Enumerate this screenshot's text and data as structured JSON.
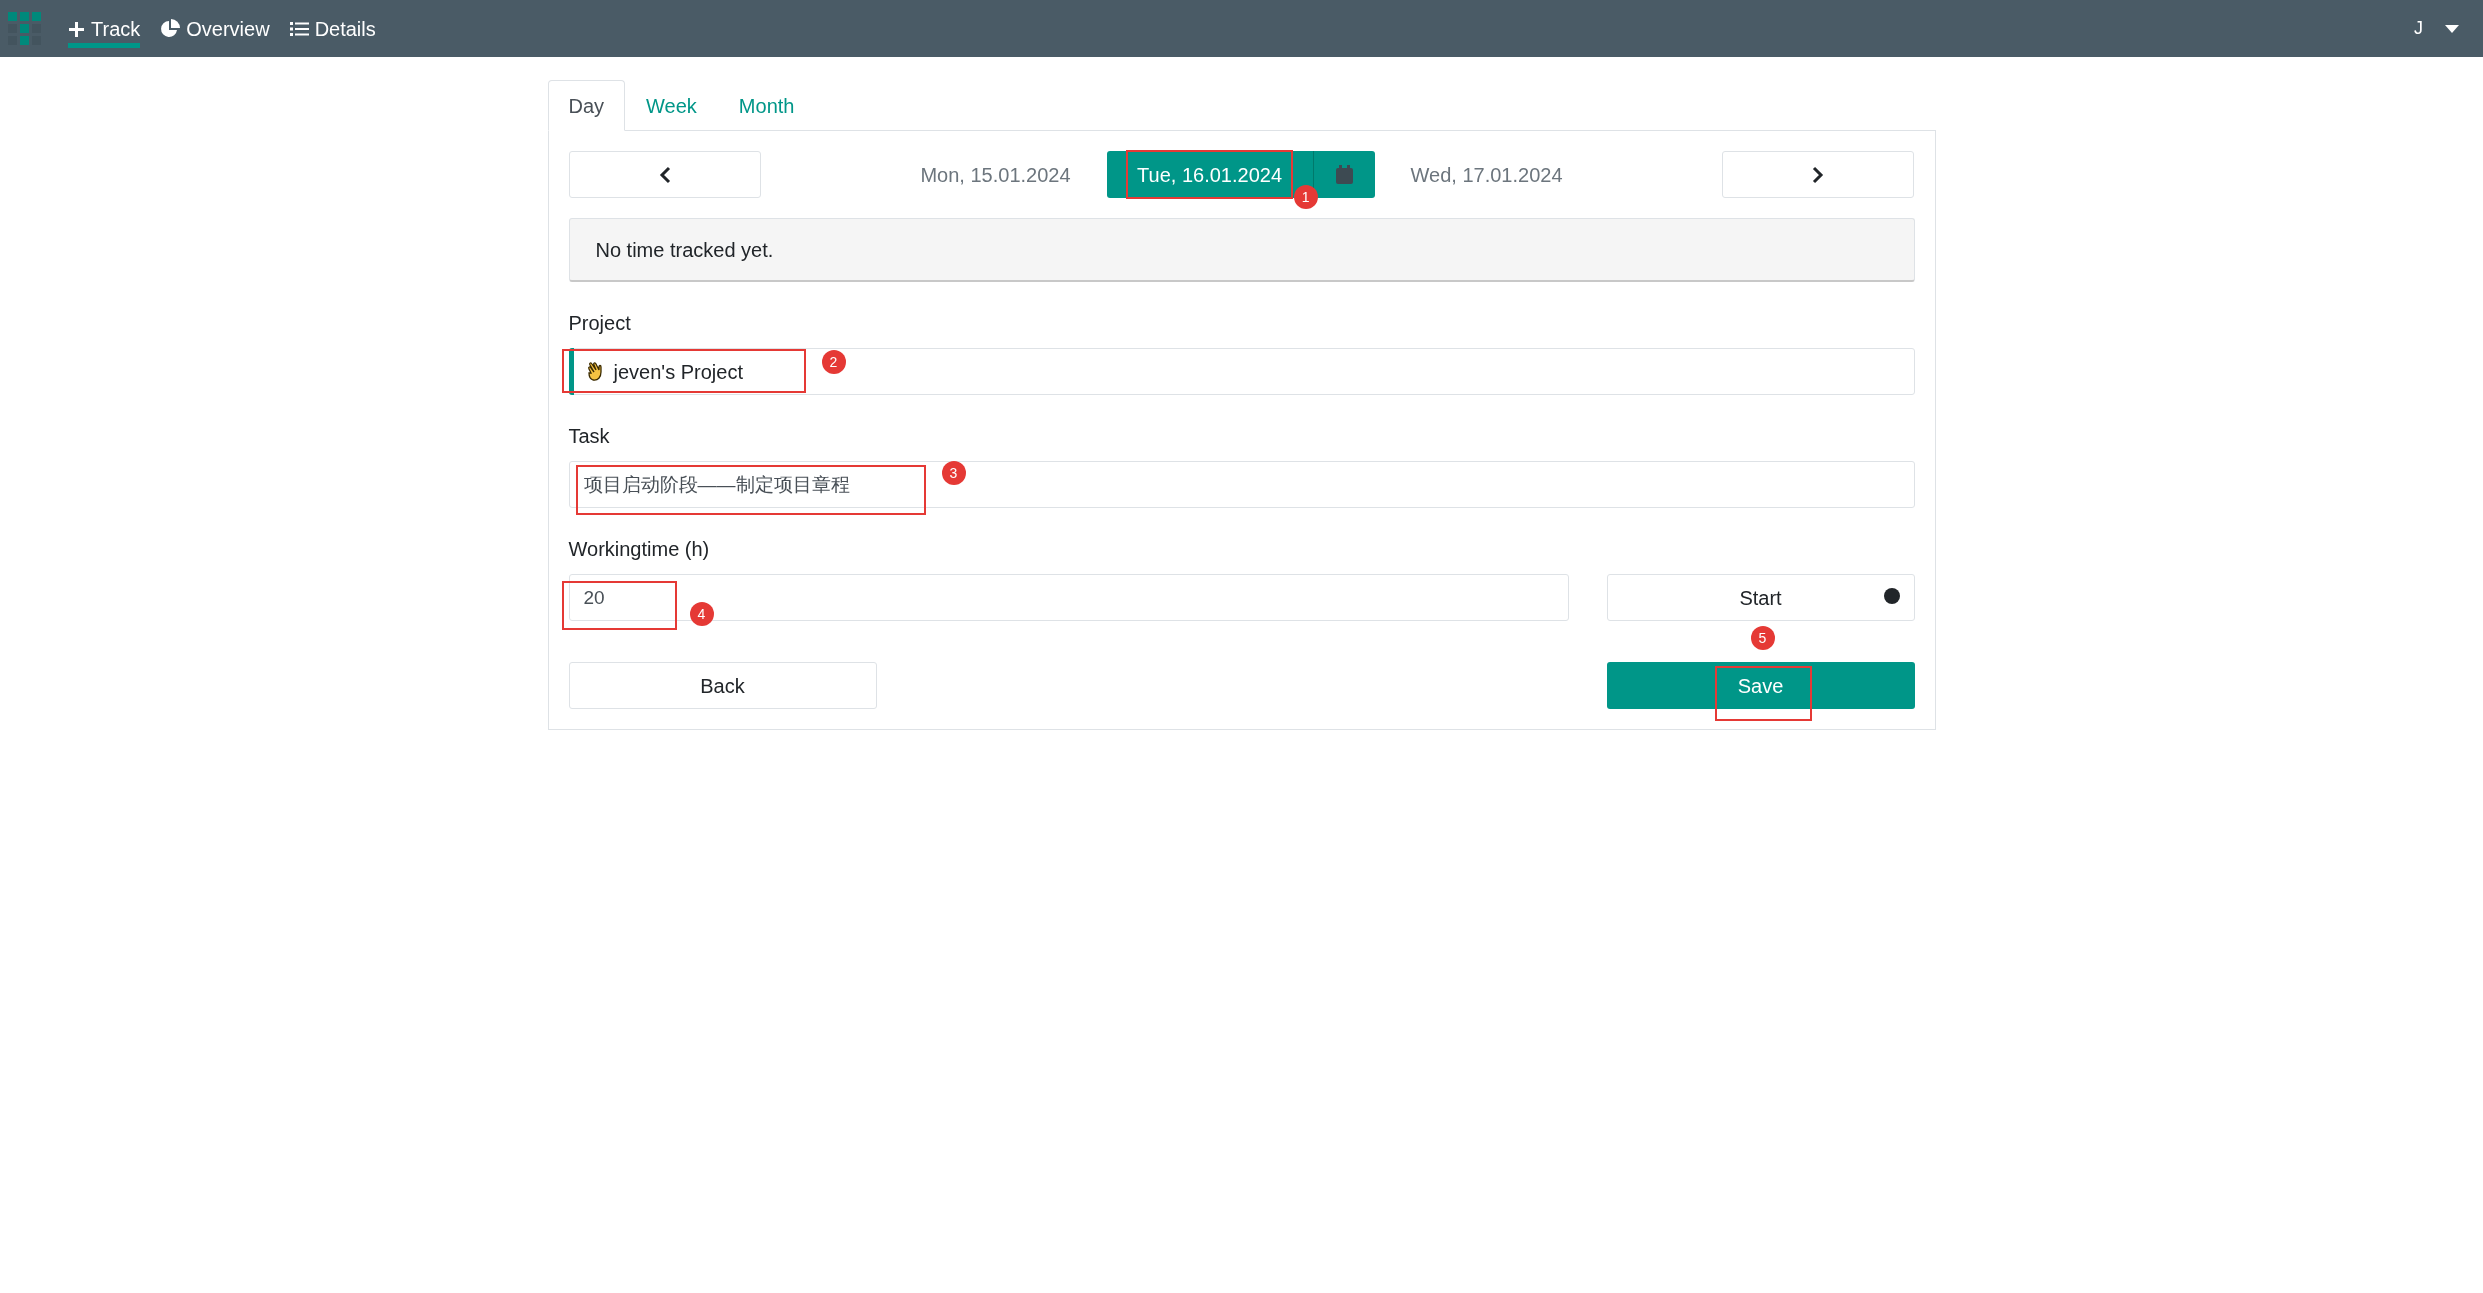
{
  "nav": {
    "items": [
      {
        "label": "Track",
        "selected": true
      },
      {
        "label": "Overview",
        "selected": false
      },
      {
        "label": "Details",
        "selected": false
      }
    ],
    "user": "J"
  },
  "tabs": [
    {
      "label": "Day",
      "selected": true
    },
    {
      "label": "Week",
      "selected": false
    },
    {
      "label": "Month",
      "selected": false
    }
  ],
  "date_nav": {
    "previous": "Mon, 15.01.2024",
    "current": "Tue, 16.01.2024",
    "next": "Wed, 17.01.2024"
  },
  "message": "No time tracked yet.",
  "project": {
    "label": "Project",
    "value": "jeven's Project",
    "color": "#009688"
  },
  "task": {
    "label": "Task",
    "value": "项目启动阶段——制定项目章程"
  },
  "workingtime": {
    "label": "Workingtime (h)",
    "value": "20"
  },
  "buttons": {
    "start": "Start",
    "back": "Back",
    "save": "Save"
  },
  "annotations": [
    {
      "number": "1"
    },
    {
      "number": "2"
    },
    {
      "number": "3"
    },
    {
      "number": "4"
    },
    {
      "number": "5"
    }
  ]
}
